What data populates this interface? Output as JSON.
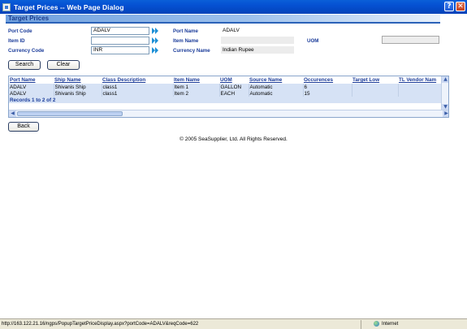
{
  "window": {
    "title": "Target Prices -- Web Page Dialog",
    "help_label": "?",
    "close_label": "✕"
  },
  "section": {
    "title": "Target Prices"
  },
  "form": {
    "port_code_label": "Port Code",
    "port_code_value": "ADALV",
    "port_name_label": "Port Name",
    "port_name_value": "ADALV",
    "item_id_label": "Item ID",
    "item_id_value": "",
    "item_name_label": "Item Name",
    "item_name_value": "",
    "uom_label": "UOM",
    "uom_value": "",
    "currency_code_label": "Currency Code",
    "currency_code_value": "INR",
    "currency_name_label": "Currency Name",
    "currency_name_value": "Indian Rupee"
  },
  "buttons": {
    "search": "Search",
    "clear": "Clear",
    "back": "Back"
  },
  "grid": {
    "columns": [
      "Port Name",
      "Ship Name",
      "Class Description",
      "Item Name",
      "UOM",
      "Source Name",
      "Occurences",
      "Target Low",
      "TL Vendor Nam"
    ],
    "rows": [
      [
        "ADALV",
        "Shivanis Ship",
        "class1",
        "Item 1",
        "GALLON",
        "Automatic",
        "6",
        "",
        ""
      ],
      [
        "ADALV",
        "Shivanis Ship",
        "class1",
        "Item 2",
        "EACH",
        "Automatic",
        "15",
        "",
        ""
      ]
    ],
    "records_text": "Records 1 to 2 of 2"
  },
  "footer": {
    "copyright": "© 2005 SeaSupplier, Ltd. All Rights Reserved."
  },
  "statusbar": {
    "url": "http://163.122.21.16/ngps/PopupTargetPriceDisplay.aspx?portCode=ADALV&reqCode=622",
    "zone": "Internet"
  }
}
